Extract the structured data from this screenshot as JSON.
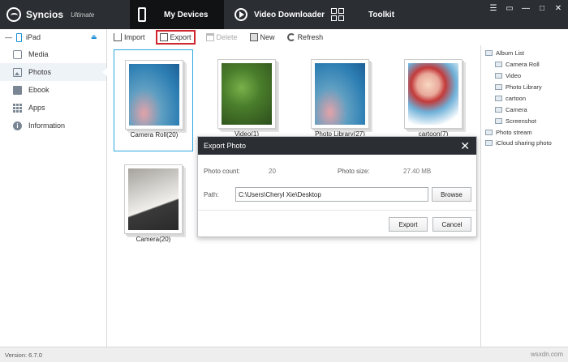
{
  "app": {
    "name": "Syncios",
    "edition": "Ultimate",
    "version": "Version: 6.7.0"
  },
  "top_tabs": [
    {
      "label": "My Devices",
      "icon": "phone-icon",
      "active": true
    },
    {
      "label": "Video Downloader",
      "icon": "play-icon",
      "active": false
    },
    {
      "label": "Toolkit",
      "icon": "grid-icon",
      "active": false
    }
  ],
  "window_controls": [
    "menu-icon",
    "chat-icon",
    "minimize-icon",
    "maximize-icon",
    "close-icon"
  ],
  "device": {
    "name": "iPad"
  },
  "sidebar": {
    "items": [
      {
        "label": "Media",
        "icon": "media-icon"
      },
      {
        "label": "Photos",
        "icon": "photo-icon",
        "active": true
      },
      {
        "label": "Ebook",
        "icon": "book-icon"
      },
      {
        "label": "Apps",
        "icon": "apps-icon"
      },
      {
        "label": "Information",
        "icon": "info-icon"
      }
    ]
  },
  "toolbar": {
    "import": "Import",
    "export": "Export",
    "delete": "Delete",
    "new": "New",
    "refresh": "Refresh"
  },
  "albums": [
    {
      "label": "Camera Roll(20)",
      "selected": true
    },
    {
      "label": "Video(1)"
    },
    {
      "label": "Photo Library(27)"
    },
    {
      "label": "cartoon(7)"
    },
    {
      "label": "Camera(20)"
    }
  ],
  "dialog": {
    "title": "Export Photo",
    "photo_count_label": "Photo count:",
    "photo_count": "20",
    "photo_size_label": "Photo size:",
    "photo_size": "27.40 MB",
    "path_label": "Path:",
    "path_value": "C:\\Users\\Cheryl Xie\\Desktop",
    "browse": "Browse",
    "export": "Export",
    "cancel": "Cancel"
  },
  "album_list": {
    "title": "Album List",
    "items": [
      "Camera Roll",
      "Video",
      "Photo Library",
      "cartoon",
      "Camera",
      "Screenshot"
    ],
    "photo_stream": "Photo stream",
    "icloud": "iCloud sharing photo"
  },
  "watermark": "wsxdn.com",
  "colors": {
    "titlebar": "#2b2e33",
    "accent": "#2ca7e0",
    "highlight": "#d0262d"
  }
}
